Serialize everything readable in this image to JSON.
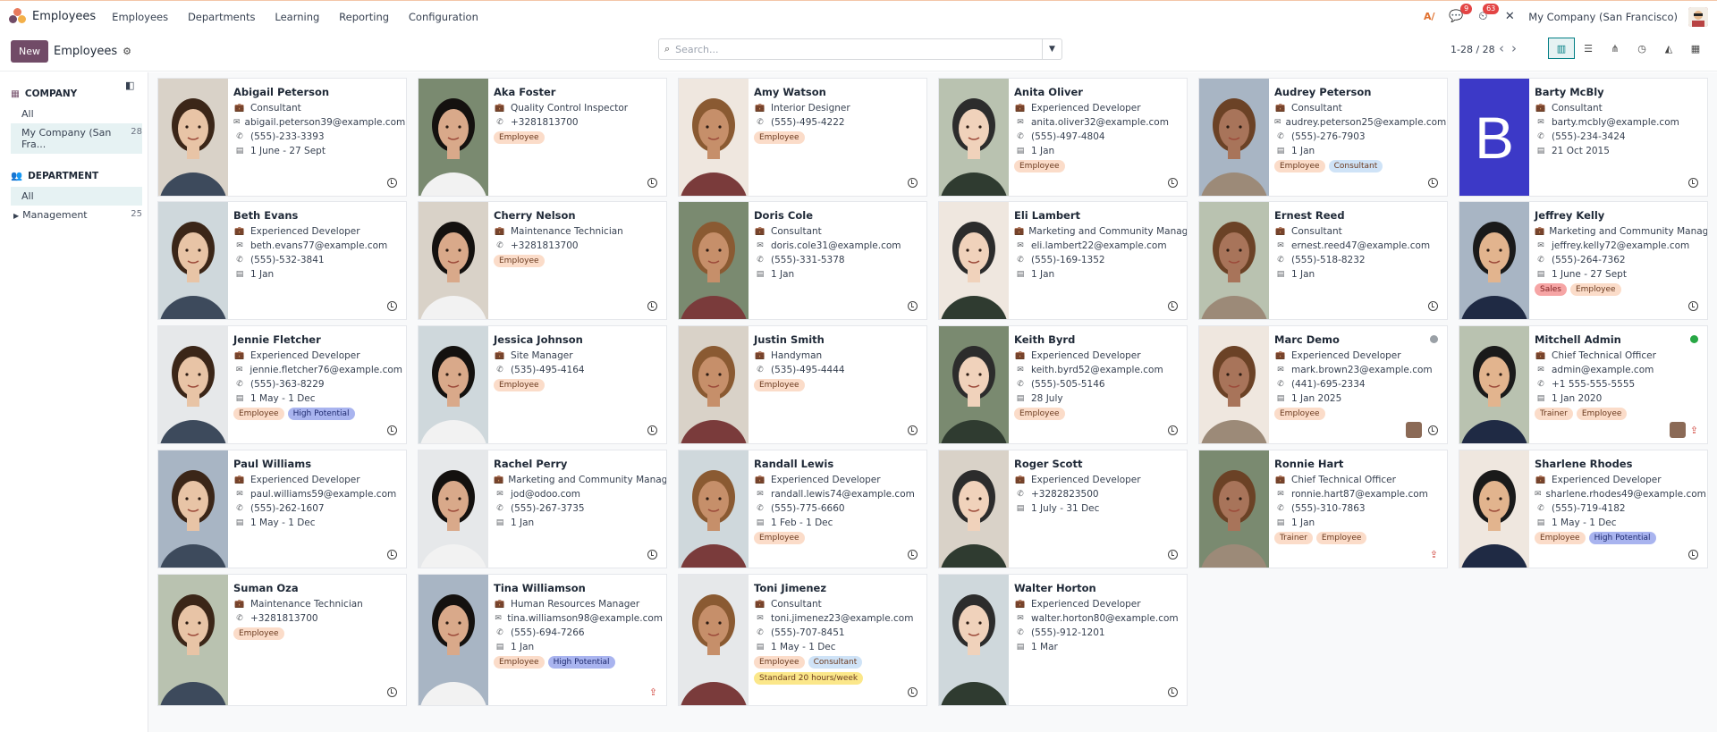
{
  "app": {
    "title": "Employees"
  },
  "menu": [
    "Employees",
    "Departments",
    "Learning",
    "Reporting",
    "Configuration"
  ],
  "topbar": {
    "badge_messages": "9",
    "badge_activities": "63",
    "company": "My Company (San Francisco)"
  },
  "control": {
    "new_label": "New",
    "breadcrumb": "Employees",
    "search_placeholder": "Search...",
    "pager": "1-28 / 28"
  },
  "sidebar": {
    "company_heading": "COMPANY",
    "company_items": [
      {
        "label": "All",
        "count": ""
      },
      {
        "label": "My Company (San Fra...",
        "count": "28"
      }
    ],
    "department_heading": "DEPARTMENT",
    "department_items": [
      {
        "label": "All",
        "count": ""
      },
      {
        "label": "Management",
        "count": "25"
      }
    ]
  },
  "tag_colors": {
    "Employee": "#fbdcc9",
    "Consultant": "#cfe3f7",
    "High Potential": "#a9b4ef",
    "Sales": "#f6a5a5",
    "Trainer": "#fbdcc9",
    "Standard 20 hours/week": "#fbe78a"
  },
  "employees": [
    {
      "name": "Abigail Peterson",
      "job": "Consultant",
      "email": "abigail.peterson39@example.com",
      "phone": "(555)-233-3393",
      "date": "1 June - 27 Sept",
      "tags": []
    },
    {
      "name": "Aka Foster",
      "job": "Quality Control Inspector",
      "email": "",
      "phone": "+3281813700",
      "date": "",
      "tags": [
        "Employee"
      ]
    },
    {
      "name": "Amy Watson",
      "job": "Interior Designer",
      "email": "",
      "phone": "(555)-495-4222",
      "date": "",
      "tags": [
        "Employee"
      ]
    },
    {
      "name": "Anita Oliver",
      "job": "Experienced Developer",
      "email": "anita.oliver32@example.com",
      "phone": "(555)-497-4804",
      "date": "1 Jan",
      "tags": [
        "Employee"
      ]
    },
    {
      "name": "Audrey Peterson",
      "job": "Consultant",
      "email": "audrey.peterson25@example.com",
      "phone": "(555)-276-7903",
      "date": "1 Jan",
      "tags": [
        "Employee",
        "Consultant"
      ]
    },
    {
      "name": "Barty McBly",
      "job": "Consultant",
      "email": "barty.mcbly@example.com",
      "phone": "(555)-234-3424",
      "date": "21 Oct 2015",
      "tags": [],
      "letter": "B"
    },
    {
      "name": "Beth Evans",
      "job": "Experienced Developer",
      "email": "beth.evans77@example.com",
      "phone": "(555)-532-3841",
      "date": "1 Jan",
      "tags": []
    },
    {
      "name": "Cherry Nelson",
      "job": "Maintenance Technician",
      "email": "",
      "phone": "+3281813700",
      "date": "",
      "tags": [
        "Employee"
      ]
    },
    {
      "name": "Doris Cole",
      "job": "Consultant",
      "email": "doris.cole31@example.com",
      "phone": "(555)-331-5378",
      "date": "1 Jan",
      "tags": []
    },
    {
      "name": "Eli Lambert",
      "job": "Marketing and Community Manager",
      "email": "eli.lambert22@example.com",
      "phone": "(555)-169-1352",
      "date": "1 Jan",
      "tags": []
    },
    {
      "name": "Ernest Reed",
      "job": "Consultant",
      "email": "ernest.reed47@example.com",
      "phone": "(555)-518-8232",
      "date": "1 Jan",
      "tags": []
    },
    {
      "name": "Jeffrey Kelly",
      "job": "Marketing and Community Manager",
      "email": "jeffrey.kelly72@example.com",
      "phone": "(555)-264-7362",
      "date": "1 June - 27 Sept",
      "tags": [
        "Sales",
        "Employee"
      ]
    },
    {
      "name": "Jennie Fletcher",
      "job": "Experienced Developer",
      "email": "jennie.fletcher76@example.com",
      "phone": "(555)-363-8229",
      "date": "1 May - 1 Dec",
      "tags": [
        "Employee",
        "High Potential"
      ]
    },
    {
      "name": "Jessica Johnson",
      "job": "Site Manager",
      "email": "",
      "phone": "(535)-495-4164",
      "date": "",
      "tags": [
        "Employee"
      ]
    },
    {
      "name": "Justin Smith",
      "job": "Handyman",
      "email": "",
      "phone": "(535)-495-4444",
      "date": "",
      "tags": [
        "Employee"
      ]
    },
    {
      "name": "Keith Byrd",
      "job": "Experienced Developer",
      "email": "keith.byrd52@example.com",
      "phone": "(555)-505-5146",
      "date": "28 July",
      "tags": [
        "Employee"
      ]
    },
    {
      "name": "Marc Demo",
      "job": "Experienced Developer",
      "email": "mark.brown23@example.com",
      "phone": "(441)-695-2334",
      "date": "1 Jan 2025",
      "tags": [
        "Employee"
      ],
      "status": "#9aa0a6",
      "mini": true
    },
    {
      "name": "Mitchell Admin",
      "job": "Chief Technical Officer",
      "email": "admin@example.com",
      "phone": "+1 555-555-5555",
      "date": "1 Jan 2020",
      "tags": [
        "Trainer",
        "Employee"
      ],
      "status": "#28a745",
      "mini": true,
      "upload": true
    },
    {
      "name": "Paul Williams",
      "job": "Experienced Developer",
      "email": "paul.williams59@example.com",
      "phone": "(555)-262-1607",
      "date": "1 May - 1 Dec",
      "tags": []
    },
    {
      "name": "Rachel Perry",
      "job": "Marketing and Community Manager",
      "email": "jod@odoo.com",
      "phone": "(555)-267-3735",
      "date": "1 Jan",
      "tags": []
    },
    {
      "name": "Randall Lewis",
      "job": "Experienced Developer",
      "email": "randall.lewis74@example.com",
      "phone": "(555)-775-6660",
      "date": "1 Feb - 1 Dec",
      "tags": [
        "Employee"
      ]
    },
    {
      "name": "Roger Scott",
      "job": "Experienced Developer",
      "email": "",
      "phone": "+3282823500",
      "date": "1 July - 31 Dec",
      "tags": []
    },
    {
      "name": "Ronnie Hart",
      "job": "Chief Technical Officer",
      "email": "ronnie.hart87@example.com",
      "phone": "(555)-310-7863",
      "date": "1 Jan",
      "tags": [
        "Trainer",
        "Employee"
      ],
      "upload": true,
      "noclock": true
    },
    {
      "name": "Sharlene Rhodes",
      "job": "Experienced Developer",
      "email": "sharlene.rhodes49@example.com",
      "phone": "(555)-719-4182",
      "date": "1 May - 1 Dec",
      "tags": [
        "Employee",
        "High Potential"
      ]
    },
    {
      "name": "Suman Oza",
      "job": "Maintenance Technician",
      "email": "",
      "phone": "+3281813700",
      "date": "",
      "tags": [
        "Employee"
      ]
    },
    {
      "name": "Tina Williamson",
      "job": "Human Resources Manager",
      "email": "tina.williamson98@example.com",
      "phone": "(555)-694-7266",
      "date": "1 Jan",
      "tags": [
        "Employee",
        "High Potential"
      ],
      "upload": true,
      "noclock": true
    },
    {
      "name": "Toni Jimenez",
      "job": "Consultant",
      "email": "toni.jimenez23@example.com",
      "phone": "(555)-707-8451",
      "date": "1 May - 1 Dec",
      "tags": [
        "Employee",
        "Consultant",
        "Standard 20 hours/week"
      ]
    },
    {
      "name": "Walter Horton",
      "job": "Experienced Developer",
      "email": "walter.horton80@example.com",
      "phone": "(555)-912-1201",
      "date": "1 Mar",
      "tags": []
    }
  ]
}
